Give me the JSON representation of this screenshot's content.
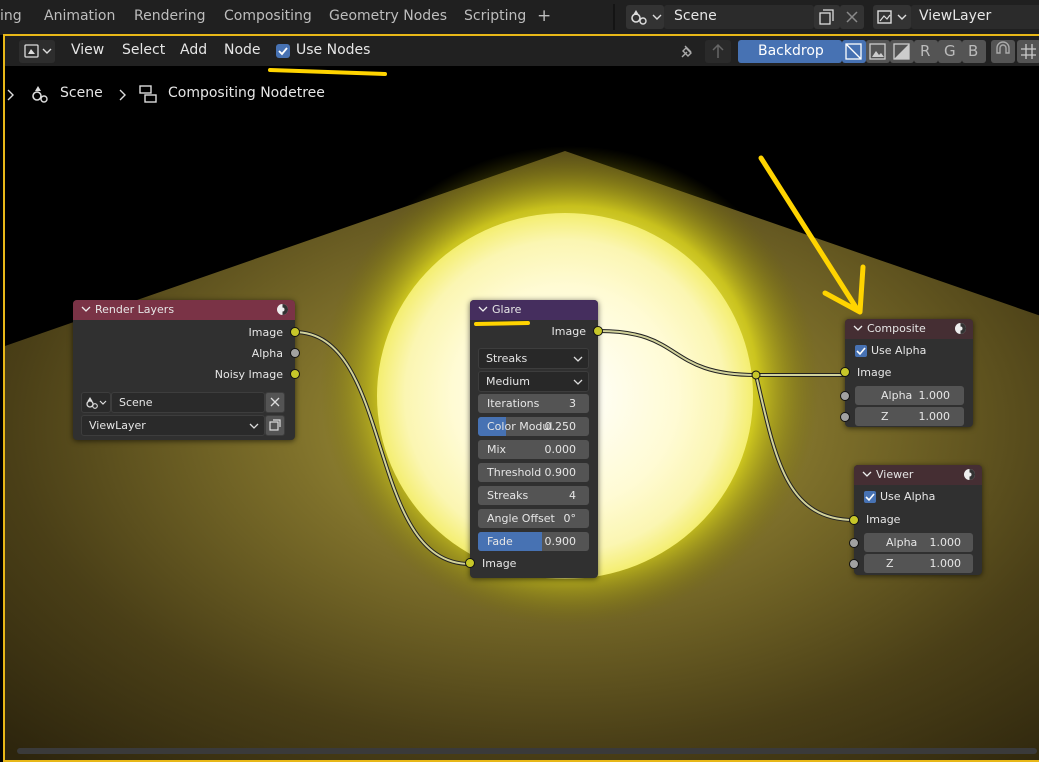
{
  "topbar": {
    "workspace_tabs": [
      "ing",
      "Animation",
      "Rendering",
      "Compositing",
      "Geometry Nodes",
      "Scripting"
    ],
    "add_tab_label": "+",
    "scene_name": "Scene",
    "view_layer_name": "ViewLayer"
  },
  "header": {
    "menus": [
      "View",
      "Select",
      "Add",
      "Node"
    ],
    "use_nodes_label": "Use Nodes",
    "use_nodes_checked": true,
    "backdrop_label": "Backdrop",
    "channels": [
      "R",
      "G",
      "B"
    ]
  },
  "breadcrumb": {
    "scene": "Scene",
    "nodetree": "Compositing Nodetree"
  },
  "nodes": {
    "render_layers": {
      "title": "Render Layers",
      "outputs": [
        "Image",
        "Alpha",
        "Noisy Image"
      ],
      "scene": "Scene",
      "layer": "ViewLayer",
      "header_color": "#7a3346"
    },
    "glare": {
      "title": "Glare",
      "output": "Image",
      "type": "Streaks",
      "quality": "Medium",
      "fields": [
        {
          "label": "Iterations",
          "value": "3",
          "fill": 0
        },
        {
          "label": "Color Modul",
          "value": "0.250",
          "fill": 0.25
        },
        {
          "label": "Mix",
          "value": "0.000",
          "fill": 0
        },
        {
          "label": "Threshold",
          "value": "0.900",
          "fill": 0
        },
        {
          "label": "Streaks",
          "value": "4",
          "fill": 0
        },
        {
          "label": "Angle Offset",
          "value": "0°",
          "fill": 0
        },
        {
          "label": "Fade",
          "value": "0.900",
          "fill": 0.58
        }
      ],
      "input": "Image",
      "header_color": "#452e5e"
    },
    "composite": {
      "title": "Composite",
      "use_alpha_label": "Use Alpha",
      "input": "Image",
      "alpha_label": "Alpha",
      "alpha_value": "1.000",
      "z_label": "Z",
      "z_value": "1.000",
      "header_color": "#452e33"
    },
    "viewer": {
      "title": "Viewer",
      "use_alpha_label": "Use Alpha",
      "input": "Image",
      "alpha_label": "Alpha",
      "alpha_value": "1.000",
      "z_label": "Z",
      "z_value": "1.000",
      "header_color": "#452e33"
    }
  },
  "colors": {
    "accent": "#4772b3",
    "image_socket": "#c7c729",
    "value_socket": "#a1a1a1",
    "annotation": "#ffd400",
    "editor_border": "#e8b818"
  }
}
